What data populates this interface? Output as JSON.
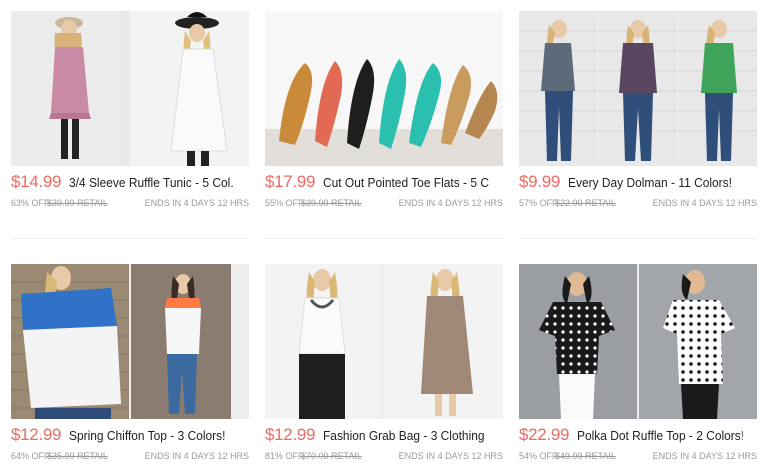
{
  "products": [
    {
      "price": "$14.99",
      "title": "3/4 Sleeve Ruffle Tunic - 5 Col...",
      "off": "63% OFF",
      "retail": "$39.99 RETAIL",
      "ends": "ENDS IN 4 DAYS 12 HRS"
    },
    {
      "price": "$17.99",
      "title": "Cut Out Pointed Toe Flats - 5 C...",
      "off": "55% OFF",
      "retail": "$39.99 RETAIL",
      "ends": "ENDS IN 4 DAYS 12 HRS"
    },
    {
      "price": "$9.99",
      "title": "Every Day Dolman - 11 Colors!",
      "off": "57% OFF",
      "retail": "$22.99 RETAIL",
      "ends": "ENDS IN 4 DAYS 12 HRS"
    },
    {
      "price": "$12.99",
      "title": "Spring Chiffon Top - 3 Colors!",
      "off": "64% OFF",
      "retail": "$35.99 RETAIL",
      "ends": "ENDS IN 4 DAYS 12 HRS"
    },
    {
      "price": "$12.99",
      "title": "Fashion Grab Bag - 3 Clothing I...",
      "off": "81% OFF",
      "retail": "$70.00 RETAIL",
      "ends": "ENDS IN 4 DAYS 12 HRS"
    },
    {
      "price": "$22.99",
      "title": "Polka Dot Ruffle Top - 2 Colors!",
      "off": "54% OFF",
      "retail": "$49.99 RETAIL",
      "ends": "ENDS IN 4 DAYS 12 HRS"
    }
  ],
  "colors": {
    "price": "#ec6b63",
    "meta": "#9a9a9a",
    "title": "#222222"
  }
}
